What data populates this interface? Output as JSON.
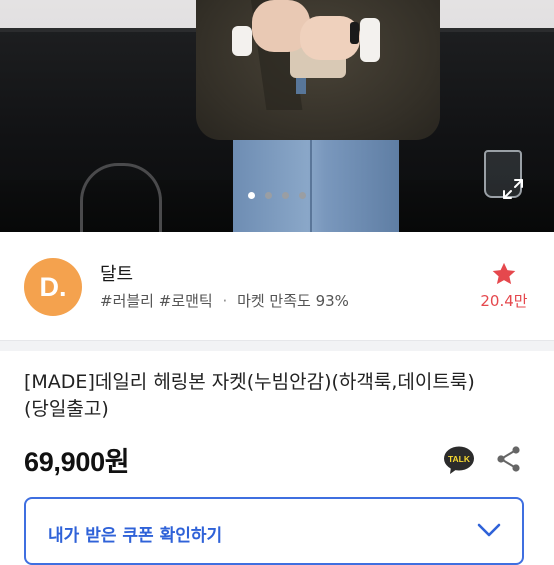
{
  "carousel": {
    "total": 4,
    "active_index": 0
  },
  "seller": {
    "logo_text": "D.",
    "name": "달트",
    "tag1": "#러블리",
    "tag2": "#로맨틱",
    "separator": "·",
    "satisfaction": "마켓 만족도 93%",
    "favorite_count": "20.4만"
  },
  "product": {
    "title": "[MADE]데일리 헤링본 자켓(누빔안감)(하객룩,데이트룩)(당일출고)",
    "price": "69,900원"
  },
  "coupon": {
    "label": "내가 받은 쿠폰 확인하기"
  },
  "icons": {
    "expand": "expand-icon",
    "star": "star-icon",
    "kakao": "kakaotalk-icon",
    "share": "share-icon",
    "chevron": "chevron-down-icon"
  },
  "colors": {
    "logo_bg": "#f4a24e",
    "favorite": "#e5484d",
    "coupon_accent": "#3f6fe0",
    "kakao_bg": "#2b2b2b"
  }
}
